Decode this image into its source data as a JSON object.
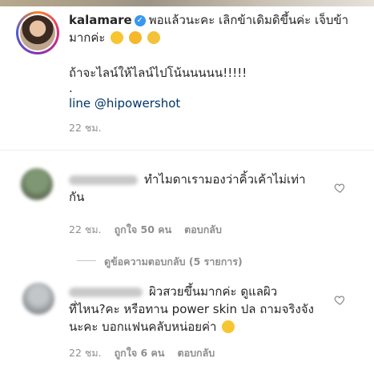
{
  "caption": {
    "username": "kalamare",
    "verified_icon": "verified-badge-icon",
    "line1": "พอแล้วนะคะ เลิกข้าเดิมดิขึ้นค่ะ เจ็บข้า",
    "line2": "มากค่ะ",
    "emojis": [
      "disappointed-face-icon",
      "crying-face-icon",
      "tired-face-icon"
    ],
    "line3": "ถ้าจะไลน์ให้ไลน์ไปโน้นนนนน!!!!!",
    "dot": ".",
    "line4": "line @hipowershot",
    "time": "22 ชม."
  },
  "comments": [
    {
      "username_blurred": "alshyah_gurl",
      "text_line1": "ทำไมดาเรามองว่าคิ้วเค้าไม่เท่า",
      "text_line2": "กัน",
      "time": "22 ชม.",
      "likes": "ถูกใจ 50 คน",
      "reply": "ตอบกลับ",
      "view_replies": "ดูข้อความตอบกลับ (5 รายการ)"
    },
    {
      "username_blurred": "Mhaena_Kaaalim",
      "text_line1": "ผิวสวยขึ้นมากค่ะ ดูแลผิว",
      "text_line2": "ที่ไหน?คะ หรือทาน power skin ปล ถามจริงจัง",
      "text_line3": "นะคะ บอกแฟนคลับหน่อยค่า",
      "emoji": "grinning-face-icon",
      "time": "22 ชม.",
      "likes": "ถูกใจ 6 คน",
      "reply": "ตอบกลับ"
    }
  ],
  "colors": {
    "text": "#262626",
    "meta": "#8e8e8e",
    "link": "#003569",
    "verified": "#3897f0"
  }
}
